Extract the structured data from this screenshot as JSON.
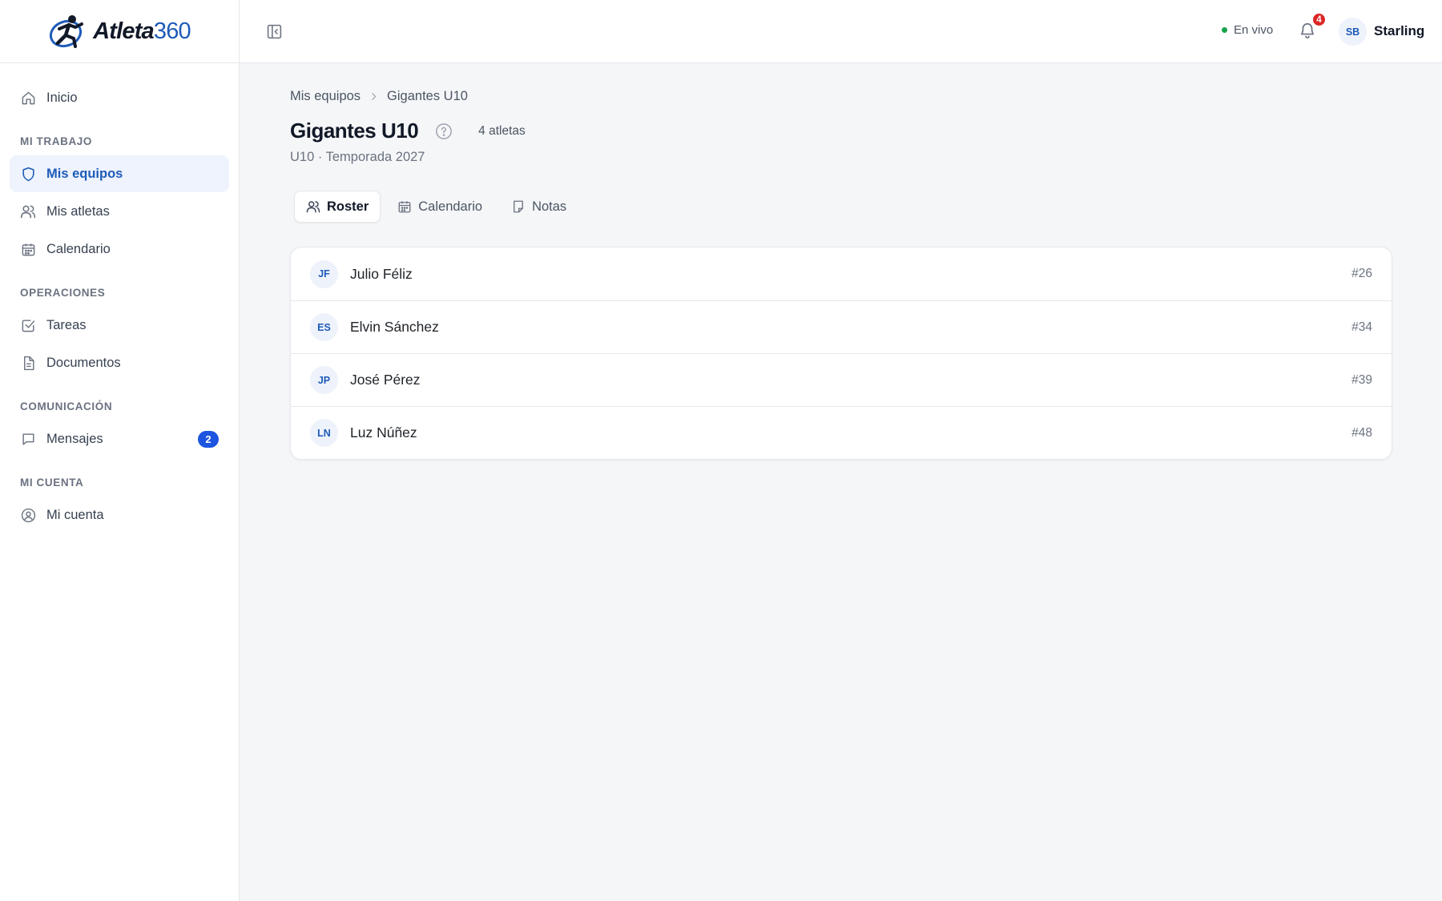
{
  "brand": {
    "name": "Atleta",
    "number": "360",
    "accent": "#1e5bb8"
  },
  "sidebar": {
    "home": {
      "label": "Inicio",
      "icon": "home-icon"
    },
    "sections": [
      {
        "title": "MI TRABAJO",
        "items": [
          {
            "label": "Mis equipos",
            "icon": "shield-icon",
            "active": true
          },
          {
            "label": "Mis atletas",
            "icon": "users-icon"
          },
          {
            "label": "Calendario",
            "icon": "calendar-icon"
          }
        ]
      },
      {
        "title": "OPERACIONES",
        "items": [
          {
            "label": "Tareas",
            "icon": "checkbox-icon"
          },
          {
            "label": "Documentos",
            "icon": "document-icon"
          }
        ]
      },
      {
        "title": "COMUNICACIÓN",
        "items": [
          {
            "label": "Mensajes",
            "icon": "message-icon",
            "badge": "2"
          }
        ]
      },
      {
        "title": "MI CUENTA",
        "items": [
          {
            "label": "Mi cuenta",
            "icon": "user-circle-icon"
          }
        ]
      }
    ]
  },
  "topbar": {
    "status": "En vivo",
    "notifications": "4",
    "user_initials": "SB",
    "user_name": "Starling"
  },
  "breadcrumb": {
    "parent": "Mis equipos",
    "current": "Gigantes U10"
  },
  "team": {
    "title": "Gigantes U10",
    "count": "4 atletas",
    "subtitle": "U10 · Temporada 2027"
  },
  "tabs": [
    {
      "label": "Roster",
      "icon": "users-icon",
      "active": true
    },
    {
      "label": "Calendario",
      "icon": "calendar-icon"
    },
    {
      "label": "Notas",
      "icon": "note-icon"
    }
  ],
  "roster": [
    {
      "initials": "JF",
      "name": "Julio Féliz",
      "number": "#26"
    },
    {
      "initials": "ES",
      "name": "Elvin Sánchez",
      "number": "#34"
    },
    {
      "initials": "JP",
      "name": "José Pérez",
      "number": "#39"
    },
    {
      "initials": "LN",
      "name": "Luz Núñez",
      "number": "#48"
    }
  ]
}
